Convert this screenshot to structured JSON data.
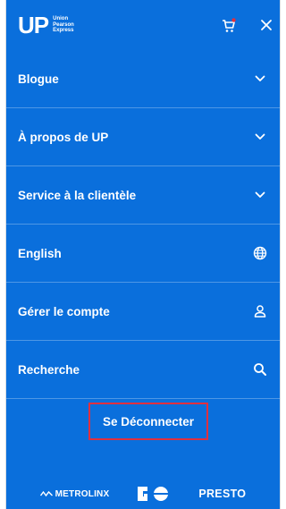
{
  "header": {
    "logo_mark": "UP",
    "logo_lines": [
      "Union",
      "Pearson",
      "Express"
    ]
  },
  "menu": {
    "items": [
      {
        "label": "Blogue",
        "icon": "chevron-down-icon"
      },
      {
        "label": "À propos de UP",
        "icon": "chevron-down-icon"
      },
      {
        "label": "Service à la clientèle",
        "icon": "chevron-down-icon"
      },
      {
        "label": "English",
        "icon": "globe-icon"
      },
      {
        "label": "Gérer le compte",
        "icon": "user-icon"
      },
      {
        "label": "Recherche",
        "icon": "search-icon"
      }
    ]
  },
  "logout": {
    "label": "Se Déconnecter",
    "highlight_color": "#e0303f"
  },
  "footer": {
    "partners": [
      "METROLINX",
      "GO",
      "PRESTO"
    ]
  },
  "colors": {
    "background": "#0a6fdc",
    "text": "#ffffff",
    "cart_badge": "#e0303f"
  }
}
